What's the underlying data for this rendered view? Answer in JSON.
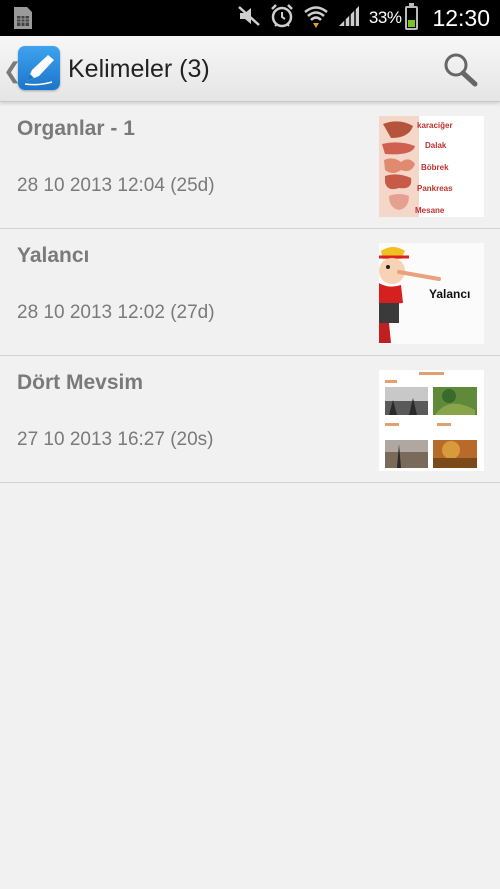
{
  "status_bar": {
    "battery_percent": "33%",
    "battery_level": 0.33,
    "time": "12:30",
    "icons": [
      "sim-card-icon",
      "mute-icon",
      "alarm-icon",
      "wifi-icon",
      "signal-icon",
      "battery-icon"
    ]
  },
  "action_bar": {
    "title": "Kelimeler (3)",
    "app_icon": "pen-nib-icon",
    "search_icon": "search-icon"
  },
  "list": {
    "items": [
      {
        "name": "Organlar - 1",
        "date": "28 10 2013 12:04 (25d)",
        "thumb_words": [
          "karaciğer",
          "Dalak",
          "Böbrek",
          "Pankreas",
          "Mesane"
        ]
      },
      {
        "name": "Yalancı",
        "date": "28 10 2013 12:02 (27d)",
        "thumb_label": "Yalancı"
      },
      {
        "name": "Dört Mevsim",
        "date": "27 10 2013 16:27 (20s)"
      }
    ]
  },
  "colors": {
    "background": "#f1f1f1",
    "text_secondary": "#7a7a7a",
    "app_icon_blue": "#1c75cb",
    "battery_green": "#7dc31f"
  }
}
